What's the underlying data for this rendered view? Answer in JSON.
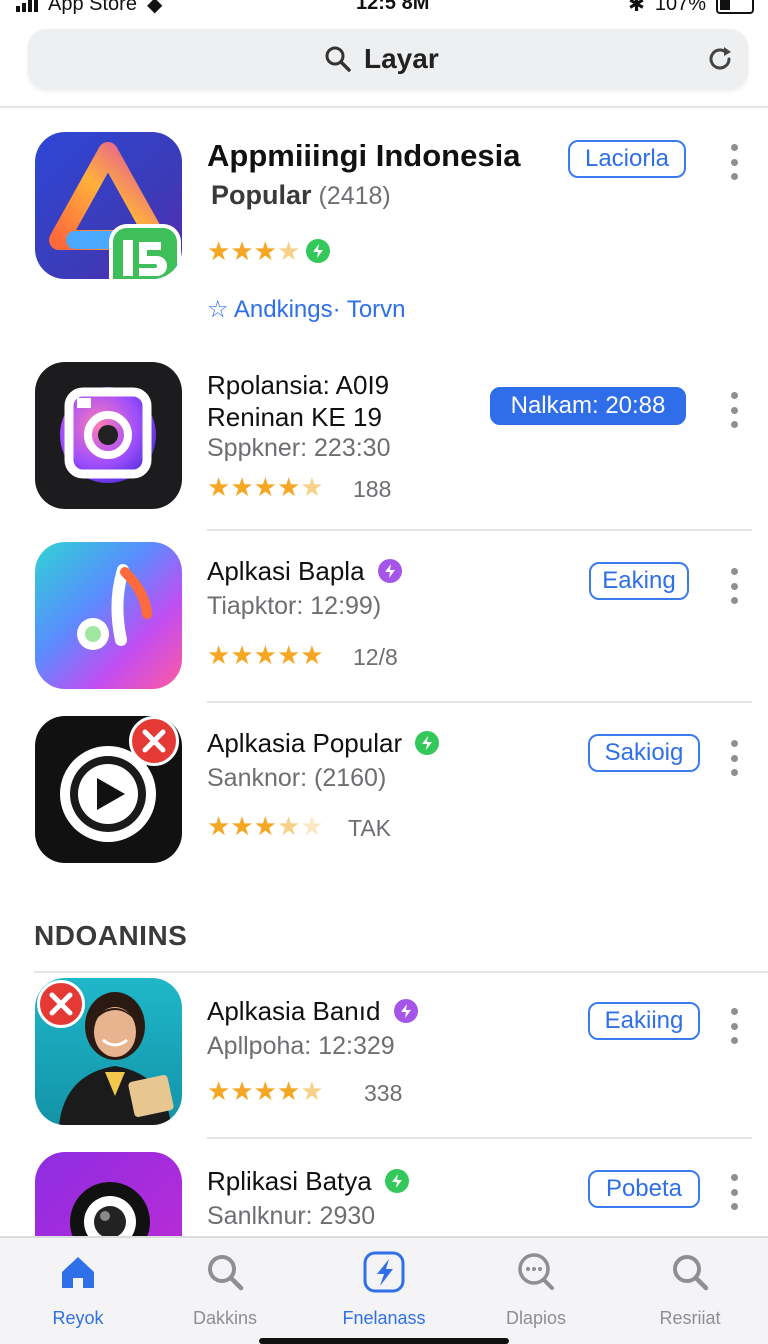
{
  "status_bar": {
    "carrier": "App Store",
    "time": "12:5 8M",
    "battery": "107%"
  },
  "search": {
    "query": "Layar"
  },
  "apps": [
    {
      "title": "Appmiiingi Indonesia",
      "subtitle_main": "Popular",
      "subtitle_count": "(2418)",
      "rating": 3.5,
      "rating_count": "",
      "action": "Laciorla",
      "link": "Andkings· Torvn",
      "badge": "green"
    },
    {
      "title": "Rpolansia: A0I9",
      "title_line2": "Reninan KE 19",
      "subtitle": "Sppkner: 223:30",
      "rating": 4.5,
      "rating_count": "188",
      "action": "Nalkam: 20:88"
    },
    {
      "title": "Aplkasi Bapla",
      "subtitle": "Tiapktor: 12:99)",
      "rating": 5,
      "rating_count": "12/8",
      "action": "Eaking",
      "badge": "purple"
    },
    {
      "title": "Aplkasia Popular",
      "subtitle": "Sanknor: (2160)",
      "rating": 3.5,
      "rating_count": "TAK",
      "action": "Sakioig",
      "badge": "green"
    }
  ],
  "section": {
    "title": "NDOANINS"
  },
  "apps_section": [
    {
      "title": "Aplkasia Banıd",
      "subtitle": "Apllpoha: 12:329",
      "rating": 4.5,
      "rating_count": "338",
      "action": "Eakiing",
      "badge": "purple"
    },
    {
      "title": "Rplikasi Batya",
      "subtitle": "Sanlknur: 2930",
      "action": "Pobeta",
      "badge": "green"
    }
  ],
  "tabs": [
    {
      "label": "Reyok",
      "icon": "home-icon",
      "active": true
    },
    {
      "label": "Dakkins",
      "icon": "search-icon",
      "active": false
    },
    {
      "label": "Fnelanass",
      "icon": "apps-icon",
      "active": false
    },
    {
      "label": "Dlapios",
      "icon": "chat-search-icon",
      "active": false
    },
    {
      "label": "Resriiat",
      "icon": "search-icon",
      "active": false
    }
  ],
  "colors": {
    "accent": "#2f6fe8",
    "star": "#f5a623",
    "badge_green": "#34c759",
    "badge_purple": "#a556e8",
    "alert_red": "#e53935"
  }
}
